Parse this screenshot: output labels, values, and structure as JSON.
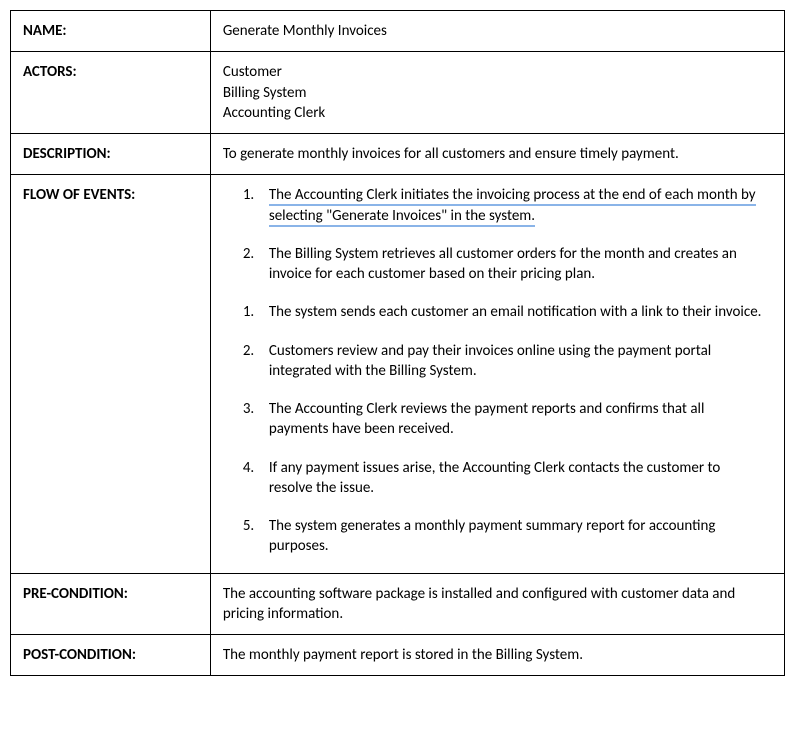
{
  "rows": {
    "name": {
      "label": "NAME:",
      "value": "Generate Monthly Invoices"
    },
    "actors": {
      "label": "ACTORS:",
      "list": [
        "Customer",
        "Billing System",
        "Accounting Clerk"
      ]
    },
    "description": {
      "label": "DESCRIPTION:",
      "value": "To generate monthly invoices for all customers and ensure timely payment."
    },
    "flow": {
      "label": "FLOW OF EVENTS:",
      "items": [
        {
          "num": "1.",
          "text": "The Accounting Clerk initiates the invoicing process at the end of each month by selecting \"Generate Invoices\" in the system.",
          "highlighted": true
        },
        {
          "num": "2.",
          "text": "The Billing System retrieves all customer orders for the month and creates an invoice for each customer based on their pricing plan.",
          "highlighted": false
        },
        {
          "num": "1.",
          "text": "The system sends each customer an email notification with a link to their invoice.",
          "highlighted": false
        },
        {
          "num": "2.",
          "text": "Customers review and pay their invoices online using the payment portal integrated with the Billing System.",
          "highlighted": false
        },
        {
          "num": "3.",
          "text": "The Accounting Clerk reviews the payment reports and confirms that all payments have been received.",
          "highlighted": false
        },
        {
          "num": "4.",
          "text": "If any payment issues arise, the Accounting Clerk contacts the customer to resolve the issue.",
          "highlighted": false
        },
        {
          "num": "5.",
          "text": "The system generates a monthly payment summary report for accounting purposes.",
          "highlighted": false
        }
      ]
    },
    "precondition": {
      "label": "PRE-CONDITION:",
      "value": "The accounting software package is installed and configured with customer data and pricing information."
    },
    "postcondition": {
      "label": "POST-CONDITION:",
      "value": "The monthly payment report is stored in the Billing System."
    }
  }
}
